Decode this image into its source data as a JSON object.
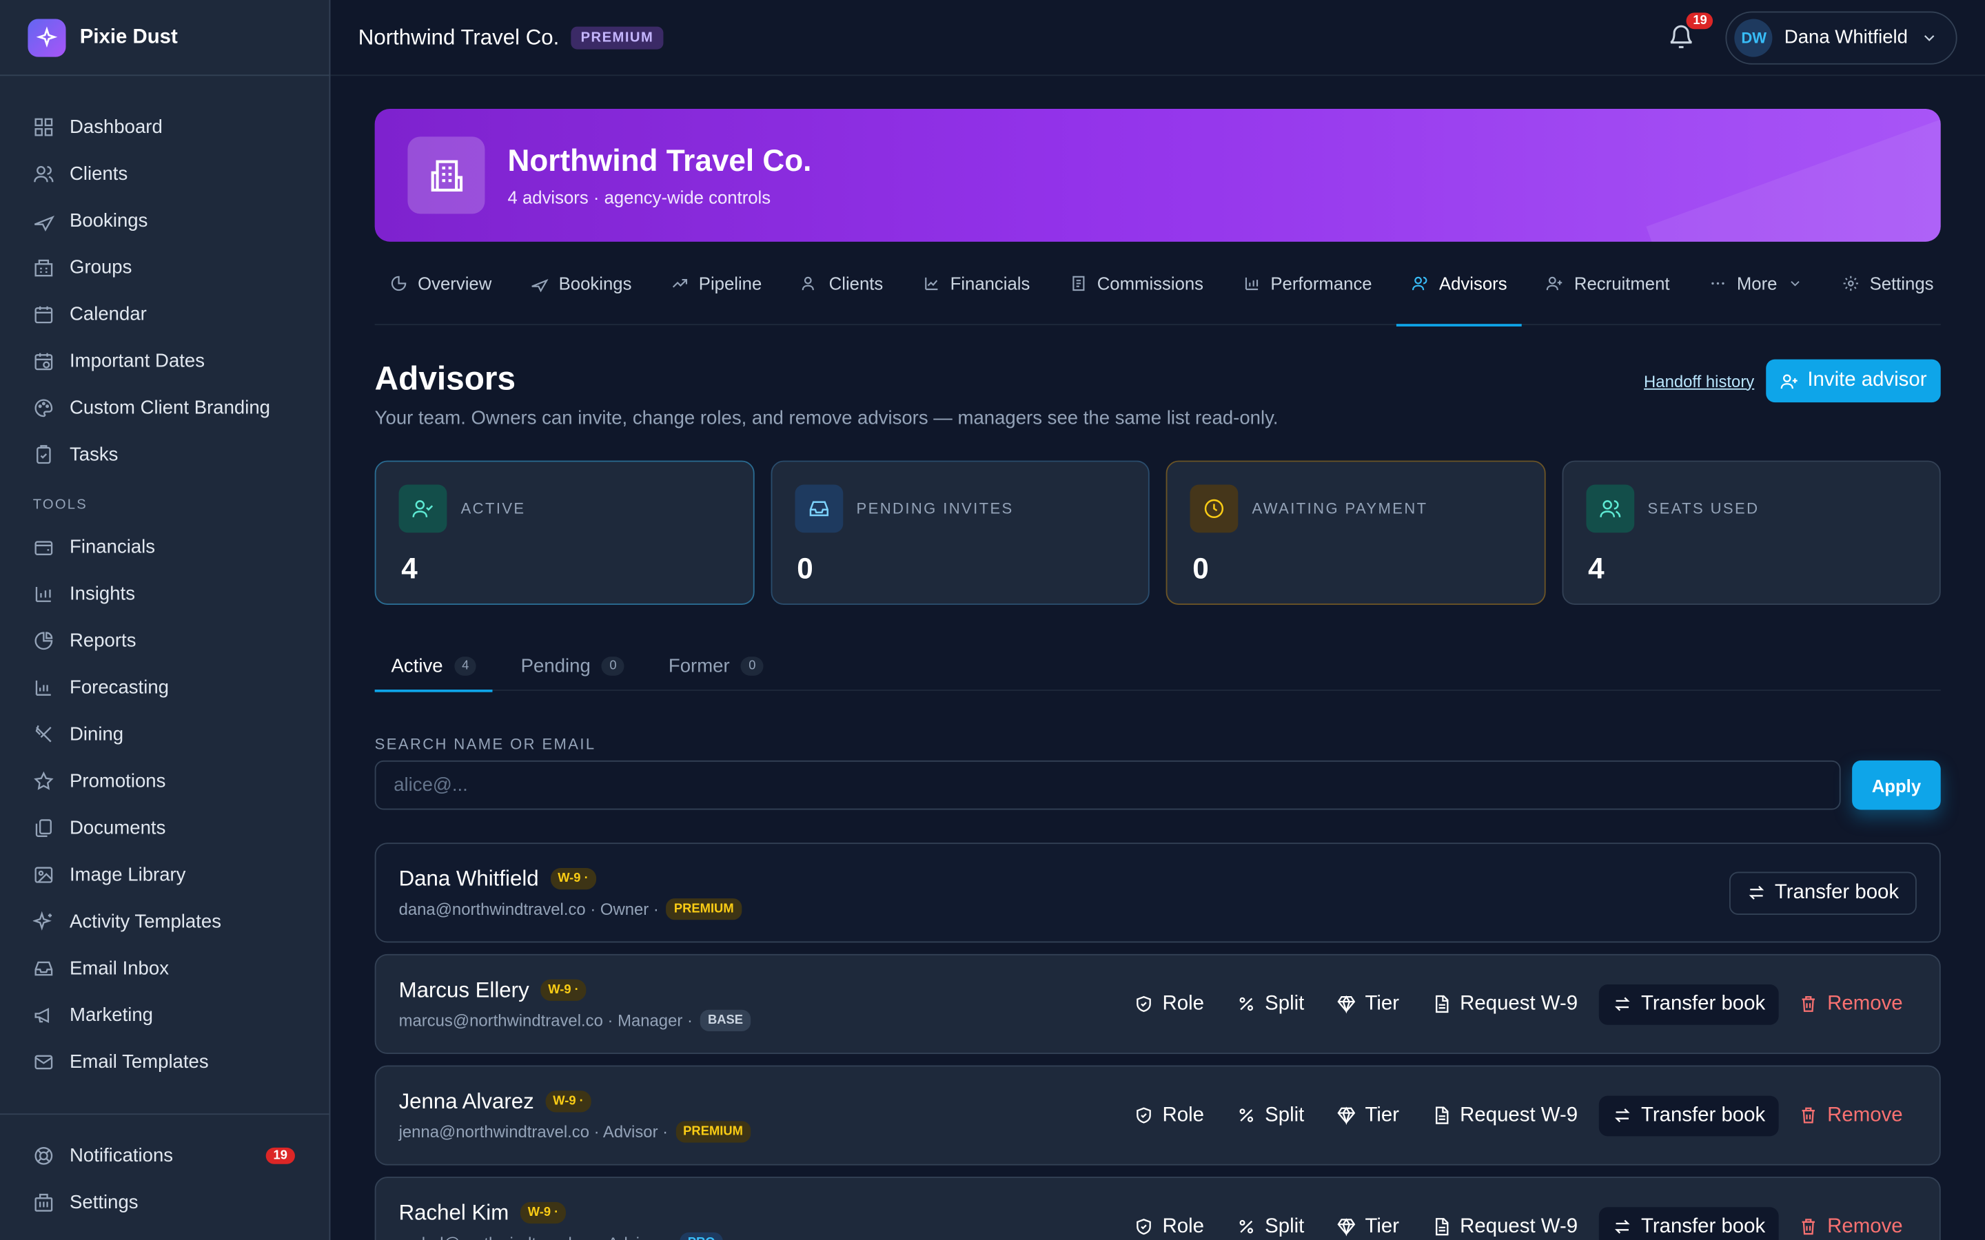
{
  "brand": {
    "name": "Pixie Dust"
  },
  "nav": {
    "main": [
      "Dashboard",
      "Clients",
      "Bookings",
      "Groups",
      "Calendar",
      "Important Dates",
      "Custom Client Branding",
      "Tasks"
    ],
    "tools_heading": "TOOLS",
    "tools": [
      "Financials",
      "Insights",
      "Reports",
      "Forecasting",
      "Dining",
      "Promotions",
      "Documents",
      "Image Library",
      "Activity Templates",
      "Email Inbox",
      "Marketing",
      "Email Templates"
    ],
    "bottom": {
      "notifications": "Notifications",
      "notifications_count": "19",
      "settings": "Settings"
    }
  },
  "topbar": {
    "org": "Northwind Travel Co.",
    "plan": "PREMIUM",
    "notifications_count": "19",
    "user_initials": "DW",
    "user_name": "Dana Whitfield"
  },
  "hero": {
    "title": "Northwind Travel Co.",
    "subtitle": "4 advisors · agency-wide controls"
  },
  "tabs": [
    "Overview",
    "Bookings",
    "Pipeline",
    "Clients",
    "Financials",
    "Commissions",
    "Performance",
    "Advisors",
    "Recruitment",
    "More",
    "Settings"
  ],
  "page": {
    "title": "Advisors",
    "subtitle": "Your team. Owners can invite, change roles, and remove advisors — managers see the same list read-only.",
    "handoff_link": "Handoff history",
    "invite_button": "Invite advisor"
  },
  "stats": [
    {
      "label": "ACTIVE",
      "value": "4"
    },
    {
      "label": "PENDING INVITES",
      "value": "0"
    },
    {
      "label": "AWAITING PAYMENT",
      "value": "0"
    },
    {
      "label": "SEATS USED",
      "value": "4"
    }
  ],
  "subtabs": [
    {
      "label": "Active",
      "count": "4"
    },
    {
      "label": "Pending",
      "count": "0"
    },
    {
      "label": "Former",
      "count": "0"
    }
  ],
  "search": {
    "label": "SEARCH NAME OR EMAIL",
    "placeholder": "alice@...",
    "apply": "Apply"
  },
  "actions": {
    "role": "Role",
    "split": "Split",
    "tier": "Tier",
    "request_w9": "Request W-9",
    "transfer": "Transfer book",
    "remove": "Remove"
  },
  "advisors": [
    {
      "name": "Dana Whitfield",
      "w9": "W-9 ·",
      "email": "dana@northwindtravel.co · Owner ·",
      "tier": "PREMIUM"
    },
    {
      "name": "Marcus Ellery",
      "w9": "W-9 ·",
      "email": "marcus@northwindtravel.co · Manager ·",
      "tier": "BASE"
    },
    {
      "name": "Jenna Alvarez",
      "w9": "W-9 ·",
      "email": "jenna@northwindtravel.co · Advisor ·",
      "tier": "PREMIUM"
    },
    {
      "name": "Rachel Kim",
      "w9": "W-9 ·",
      "email": "rachel@northwindtravel.co · Advisor ·",
      "tier": "PRO"
    }
  ]
}
